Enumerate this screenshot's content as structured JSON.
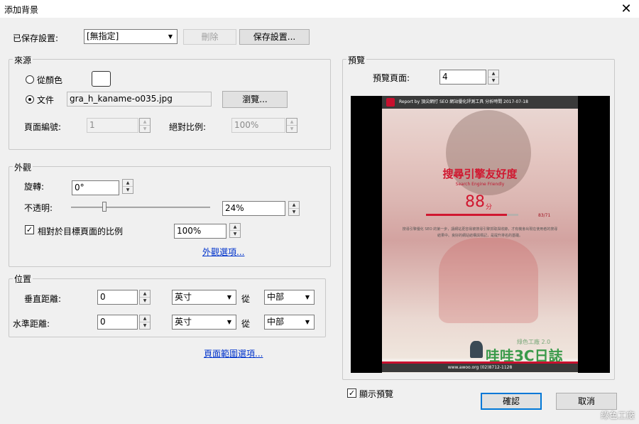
{
  "window": {
    "title": "添加背景",
    "close_glyph": "✕"
  },
  "saved_settings": {
    "label": "已保存設置:",
    "value": "[無指定]",
    "delete_label": "刪除",
    "save_label": "保存設置..."
  },
  "source": {
    "group_title": "來源",
    "from_color_label": "從顏色",
    "file_label": "文件",
    "file_value": "gra_h_kaname-o035.jpg",
    "browse_label": "瀏覽...",
    "page_number_label": "頁面編號:",
    "page_number_value": "1",
    "absolute_scale_label": "絕對比例:",
    "absolute_scale_value": "100%"
  },
  "appearance": {
    "group_title": "外觀",
    "rotation_label": "旋轉:",
    "rotation_value": "0°",
    "opacity_label": "不透明:",
    "opacity_value": "24%",
    "opacity_fraction": 0.24,
    "relative_label": "相對於目標頁面的比例",
    "relative_value": "100%",
    "relative_checked_glyph": "✓",
    "options_link": "外觀選項..."
  },
  "position": {
    "group_title": "位置",
    "vertical_label": "垂直距離:",
    "vertical_value": "0",
    "vertical_unit": "英寸",
    "vertical_from_label": "從",
    "vertical_from_value": "中部",
    "horizontal_label": "水準距離:",
    "horizontal_value": "0",
    "horizontal_unit": "英寸",
    "horizontal_from_label": "從",
    "horizontal_from_value": "中部"
  },
  "page_range_link": "頁面範圍選項...",
  "preview": {
    "group_title": "預覽",
    "page_label": "預覽頁面:",
    "page_value": "4",
    "show_preview_label": "顯示預覽",
    "show_preview_glyph": "✓",
    "doc": {
      "header_text": "Report by 頂尖網打 SEO 網站優化評測工具   分析時間 2017-07-18",
      "title": "搜尋引擎友好度",
      "subtitle": "Search Engine Friendly",
      "score": "88",
      "score_unit": "分",
      "ratio": "83/71",
      "paragraph": "搜尋引擎優化 SEO 的第一步，讓網站更容易被搜尋引擎抓取與收錄，才有機會出現在使用者的搜尋結果中。良好的網站結構與標記，是提升排名的基礎。",
      "logo_small": "綠色工廠 2.0",
      "logo_big": "哇哇3C日誌",
      "footer": "www.awoo.org  (02)8712-1128",
      "score_fraction": 0.88
    }
  },
  "buttons": {
    "ok_label": "確認",
    "cancel_label": "取消"
  },
  "watermark": "綠色工廠",
  "icons": {
    "spin_up": "▲",
    "spin_down": "▼",
    "combo_arrow": "▼"
  }
}
